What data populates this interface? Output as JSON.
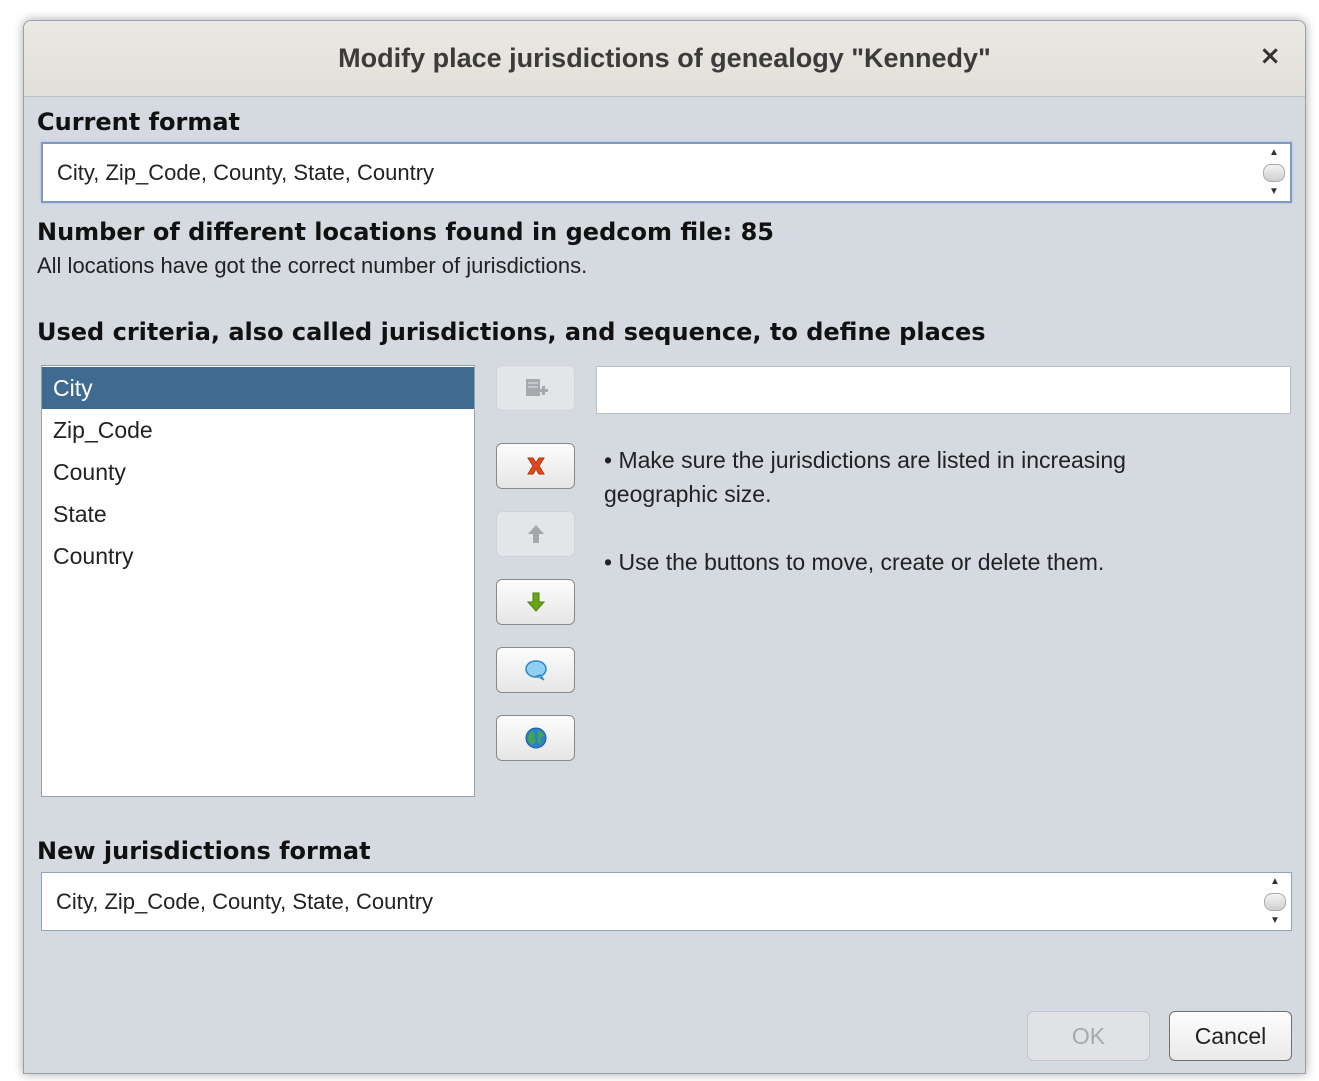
{
  "dialog": {
    "title": "Modify place jurisdictions of genealogy \"Kennedy\"",
    "close_glyph": "×"
  },
  "current_format": {
    "label": "Current format",
    "value": "City, Zip_Code, County, State, Country"
  },
  "locations": {
    "count_label": "Number of different locations found in gedcom file: 85",
    "status_text": "All locations have got the correct number of jurisdictions."
  },
  "criteria": {
    "label": "Used criteria, also called jurisdictions, and sequence, to define places",
    "items": [
      {
        "label": "City",
        "selected": true
      },
      {
        "label": "Zip_Code",
        "selected": false
      },
      {
        "label": "County",
        "selected": false
      },
      {
        "label": "State",
        "selected": false
      },
      {
        "label": "Country",
        "selected": false
      }
    ],
    "new_item_value": ""
  },
  "tools": [
    {
      "icon": "add-jurisdiction-icon",
      "enabled": false
    },
    {
      "icon": "delete-icon",
      "enabled": true,
      "color": "#e04a1a"
    },
    {
      "icon": "arrow-up-icon",
      "enabled": false
    },
    {
      "icon": "arrow-down-icon",
      "enabled": true,
      "color": "#6aa416"
    },
    {
      "icon": "speech-bubble-icon",
      "enabled": true,
      "color": "#4aa3df"
    },
    {
      "icon": "globe-icon",
      "enabled": true,
      "color": "#2a8f3a"
    }
  ],
  "help": {
    "bullet_1": "Make sure the jurisdictions are listed in increasing geographic size.",
    "bullet_2": "Use the buttons to move, create or delete them.",
    "bullet_glyph": "•"
  },
  "new_format": {
    "label": "New jurisdictions format",
    "value": "City, Zip_Code, County, State, Country"
  },
  "buttons": {
    "ok_label": "OK",
    "cancel_label": "Cancel",
    "ok_enabled": false
  },
  "colors": {
    "selection": "#3f6b91",
    "dialog_bg": "#d5d9e0"
  }
}
